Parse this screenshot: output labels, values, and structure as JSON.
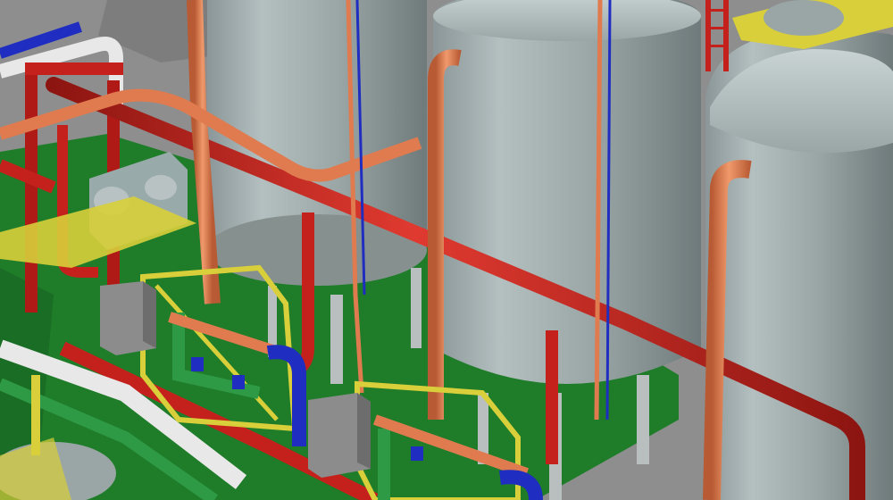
{
  "scene": {
    "palette": {
      "floor_gray": "#8e8e8e",
      "floor_green": "#1f7d2a",
      "tank_gray": "#9aa6a6",
      "pipe_orange": "#e07b4f",
      "pipe_red": "#c4211c",
      "pipe_blue": "#1f2ec0",
      "pipe_white": "#e8e8e8",
      "frame_yellow": "#d8cf3a",
      "valve_green": "#2f9a46",
      "box_gray": "#8c8c8c"
    },
    "objects": {
      "tanks": 3,
      "equipment_skids": 2,
      "electrical_boxes": 2,
      "ladders": 1
    }
  }
}
